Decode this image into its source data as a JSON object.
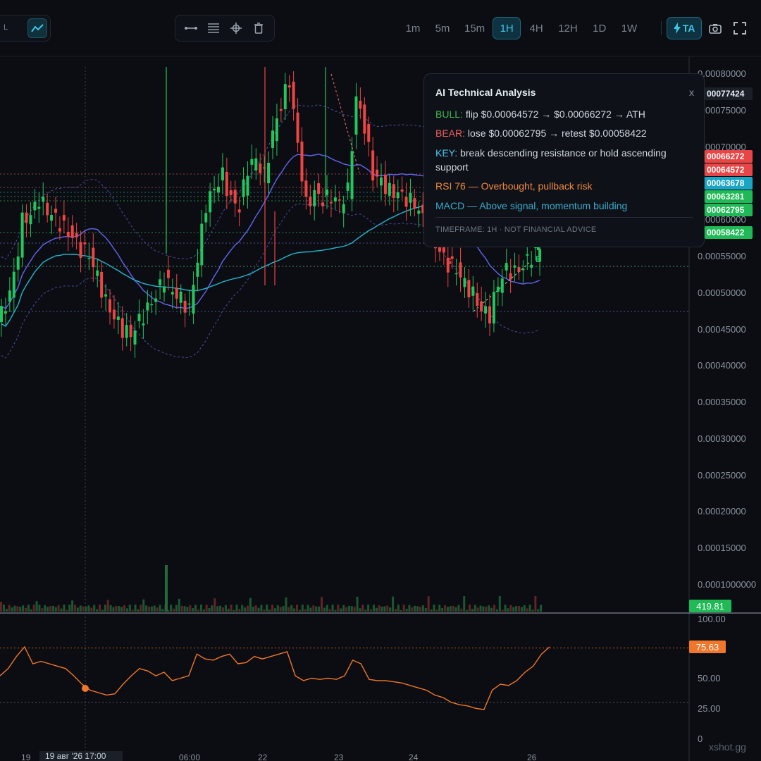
{
  "toolbar": {
    "mode_label": "L",
    "timeframes": [
      "1m",
      "5m",
      "15m",
      "1H",
      "4H",
      "12H",
      "1D",
      "1W"
    ],
    "active_timeframe": "1H",
    "ta_label": "TA"
  },
  "price_axis": {
    "ticks": [
      "0.00080000",
      "0.00075000",
      "0.00070000",
      "0.00065000",
      "0.00060000",
      "0.00055000",
      "0.00050000",
      "0.00045000",
      "0.00040000",
      "0.00035000",
      "0.00030000",
      "0.00025000",
      "0.00020000",
      "0.00015000",
      "0.0001000000"
    ],
    "current_price_tag": "00077424",
    "level_tags": [
      {
        "text": "00066272",
        "color": "#e84646"
      },
      {
        "text": "00064572",
        "color": "#e84646"
      },
      {
        "text": "00063678",
        "color": "#1aa5c4"
      },
      {
        "text": "00063281",
        "color": "#1fb955"
      },
      {
        "text": "00062795",
        "color": "#1fb955"
      },
      {
        "text": "00058422",
        "color": "#1fb955"
      }
    ]
  },
  "volume_tag": "419.81",
  "rsi_axis": {
    "ticks": [
      "100.00",
      "75.00",
      "50.00",
      "25.00",
      "0"
    ],
    "value_tag": "75.63"
  },
  "date_axis": {
    "labels": [
      "19",
      "06:00",
      "22",
      "23",
      "24",
      "26"
    ],
    "cursor_label": "19 авг '26   17:00"
  },
  "signals": {
    "sell": "S",
    "buy": "B"
  },
  "watermark": "xshot.gg",
  "analysis": {
    "title": "AI Technical Analysis",
    "close": "x",
    "bull_label": "BULL:",
    "bull_text": "flip $0.00064572 → $0.00066272 → ATH",
    "bear_label": "BEAR:",
    "bear_text": "lose $0.00062795 → retest $0.00058422",
    "key_label": "KEY:",
    "key_text": "break descending resistance or hold ascending support",
    "rsi_text": "RSI 76 — Overbought, pullback risk",
    "macd_text": "MACD — Above signal, momentum building",
    "footer": "TIMEFRAME: 1H · NOT FINANCIAL ADVICE"
  },
  "colors": {
    "up": "#22c55e",
    "down": "#ef4444",
    "rsi_line": "#f0762b",
    "band": "#5b5fc7",
    "ma_short": "#6366f1",
    "ma_long": "#22b8cf",
    "accent": "#3cc6e6"
  },
  "chart_data": {
    "type": "candlestick",
    "price_unit": "price",
    "ylim": [
      0.0001,
      0.0008
    ],
    "horizontal_levels": [
      0.00066272,
      0.00064572,
      0.00063678,
      0.00063281,
      0.00062795,
      0.00058422,
      0.00055,
      0.00054,
      0.000475
    ],
    "close_path": [
      0.00046,
      0.00048,
      0.00052,
      0.0006,
      0.00061,
      0.00063,
      0.00061,
      0.0006,
      0.00059,
      0.00058,
      0.00056,
      0.00055,
      0.00052,
      0.00049,
      0.00047,
      0.00045,
      0.00044,
      0.00046,
      0.00048,
      0.0005,
      0.00052,
      0.0005,
      0.00049,
      0.00048,
      0.00055,
      0.00062,
      0.00064,
      0.00066,
      0.00063,
      0.00062,
      0.00067,
      0.00068,
      0.00066,
      0.00072,
      0.00076,
      0.00079,
      0.0007,
      0.00062,
      0.00064,
      0.00063,
      0.00063,
      0.00062,
      0.00064,
      0.00077,
      0.00073,
      0.00066,
      0.00065,
      0.00064,
      0.00064,
      0.00063,
      0.00062,
      0.0006,
      0.00058,
      0.00056,
      0.00054,
      0.00053,
      0.00051,
      0.0005,
      0.00048,
      0.00047,
      0.00051,
      0.00053,
      0.00053,
      0.00054,
      0.00055,
      0.00056
    ],
    "rsi_values": [
      52,
      58,
      68,
      76,
      62,
      64,
      62,
      60,
      58,
      52,
      45,
      40,
      38,
      36,
      37,
      45,
      52,
      58,
      56,
      52,
      55,
      48,
      50,
      52,
      70,
      66,
      65,
      68,
      70,
      62,
      63,
      68,
      66,
      68,
      70,
      72,
      52,
      48,
      50,
      49,
      50,
      49,
      52,
      65,
      62,
      49,
      48,
      48,
      47,
      46,
      44,
      42,
      40,
      36,
      34,
      30,
      28,
      27,
      25,
      24,
      40,
      45,
      44,
      48,
      55,
      60,
      70,
      76
    ]
  }
}
